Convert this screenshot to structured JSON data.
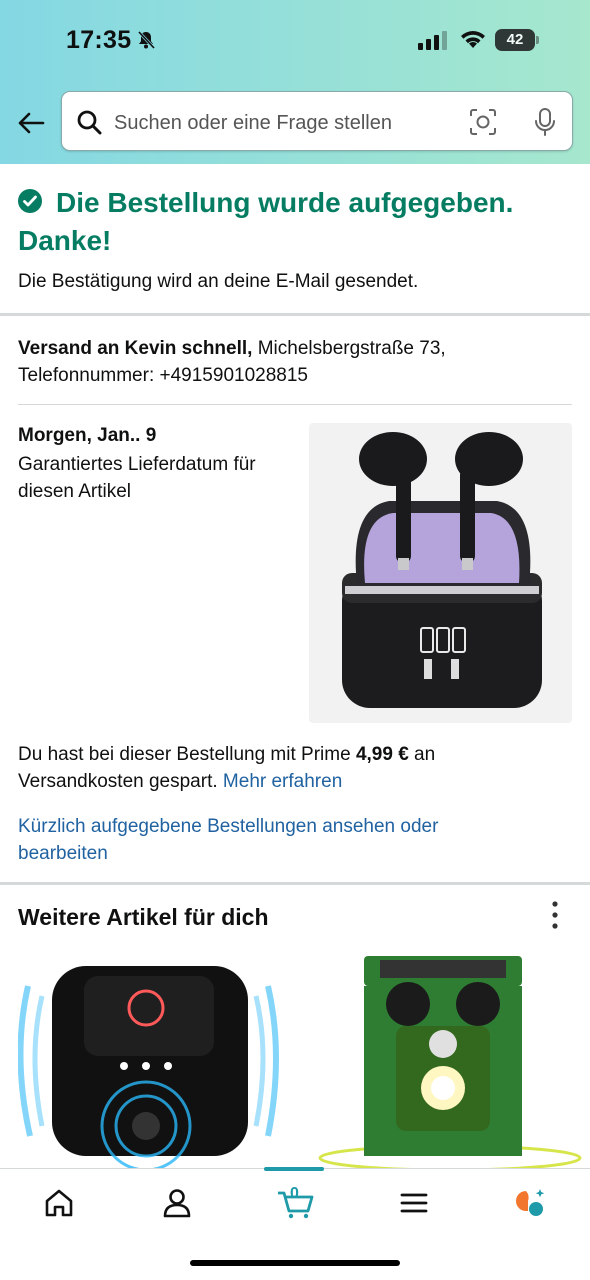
{
  "status_bar": {
    "time": "17:35",
    "battery": "42"
  },
  "search": {
    "placeholder": "Suchen oder eine Frage stellen"
  },
  "confirmation": {
    "title": "Die Bestellung wurde aufgegeben. Danke!",
    "subtitle": "Die Bestätigung wird an deine E-Mail gesendet."
  },
  "shipping": {
    "label": "Versand an Kevin schnell,",
    "address": "Michelsbergstraße 73, Telefonnummer: +4915901028815"
  },
  "delivery": {
    "date": "Morgen, Jan.. 9",
    "note": "Garantiertes Lieferdatum für diesen Artikel"
  },
  "prime_savings": {
    "text_before": "Du hast bei dieser Bestellung mit Prime",
    "amount": "4,99 €",
    "text_after": "an Versandkosten gespart.",
    "link": "Mehr erfahren"
  },
  "orders_link": "Kürzlich aufgegebene Bestellungen ansehen oder bearbeiten",
  "recommendations": {
    "title": "Weitere Artikel für dich"
  },
  "tabbar": {
    "cart_count": "0",
    "items": [
      "home-icon",
      "account-icon",
      "cart-icon",
      "menu-icon",
      "rufus-icon"
    ],
    "accent": "#1E9AA8"
  },
  "colors": {
    "success_green": "#067D62",
    "link_blue": "#2162A1",
    "header_start": "#84D8E3",
    "header_end": "#A6E7CE"
  }
}
